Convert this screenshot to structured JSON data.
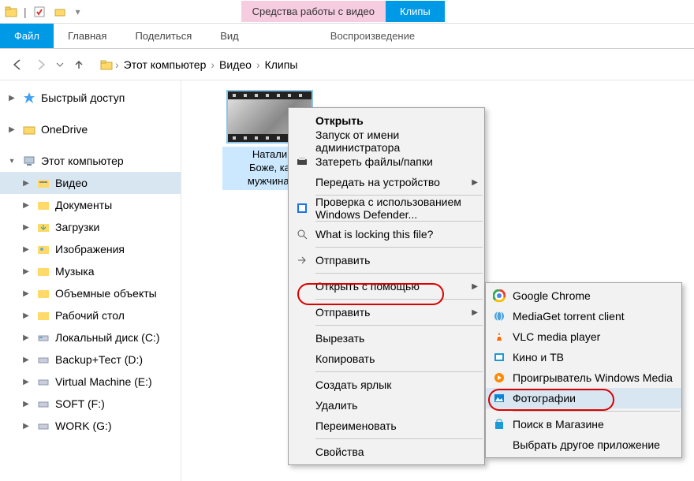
{
  "titlebar": {
    "context_tools": "Средства работы с видео",
    "window_title": "Клипы"
  },
  "ribbon": {
    "file": "Файл",
    "home": "Главная",
    "share": "Поделиться",
    "view": "Вид",
    "playback": "Воспроизведение"
  },
  "breadcrumb": {
    "this_pc": "Этот компьютер",
    "videos": "Видео",
    "clips": "Клипы"
  },
  "sidebar": {
    "quick_access": "Быстрый доступ",
    "onedrive": "OneDrive",
    "this_pc": "Этот компьютер",
    "children": {
      "videos": "Видео",
      "documents": "Документы",
      "downloads": "Загрузки",
      "pictures": "Изображения",
      "music": "Музыка",
      "objects3d": "Объемные объекты",
      "desktop": "Рабочий стол",
      "local_c": "Локальный диск (C:)",
      "backup_d": "Backup+Тест (D:)",
      "vm_e": "Virtual Machine (E:)",
      "soft_f": "SOFT (F:)",
      "work_g": "WORK (G:)"
    }
  },
  "file": {
    "name_line1": "Натали",
    "name_line2": "Боже, ка",
    "name_line3": "мужчина!"
  },
  "context_menu": {
    "open": "Открыть",
    "run_as_admin": "Запуск от имени администратора",
    "erase": "Затереть файлы/папки",
    "cast": "Передать на устройство",
    "defender": "Проверка с использованием Windows Defender...",
    "whatlock": "What is locking this file?",
    "send1": "Отправить",
    "open_with": "Открыть с помощью",
    "send2": "Отправить",
    "cut": "Вырезать",
    "copy": "Копировать",
    "shortcut": "Создать ярлык",
    "delete": "Удалить",
    "rename": "Переименовать",
    "properties": "Свойства"
  },
  "open_with_menu": {
    "chrome": "Google Chrome",
    "mediaget": "MediaGet torrent client",
    "vlc": "VLC media player",
    "movies_tv": "Кино и ТВ",
    "wmp": "Проигрыватель Windows Media",
    "photos": "Фотографии",
    "store": "Поиск в Магазине",
    "other": "Выбрать другое приложение"
  }
}
